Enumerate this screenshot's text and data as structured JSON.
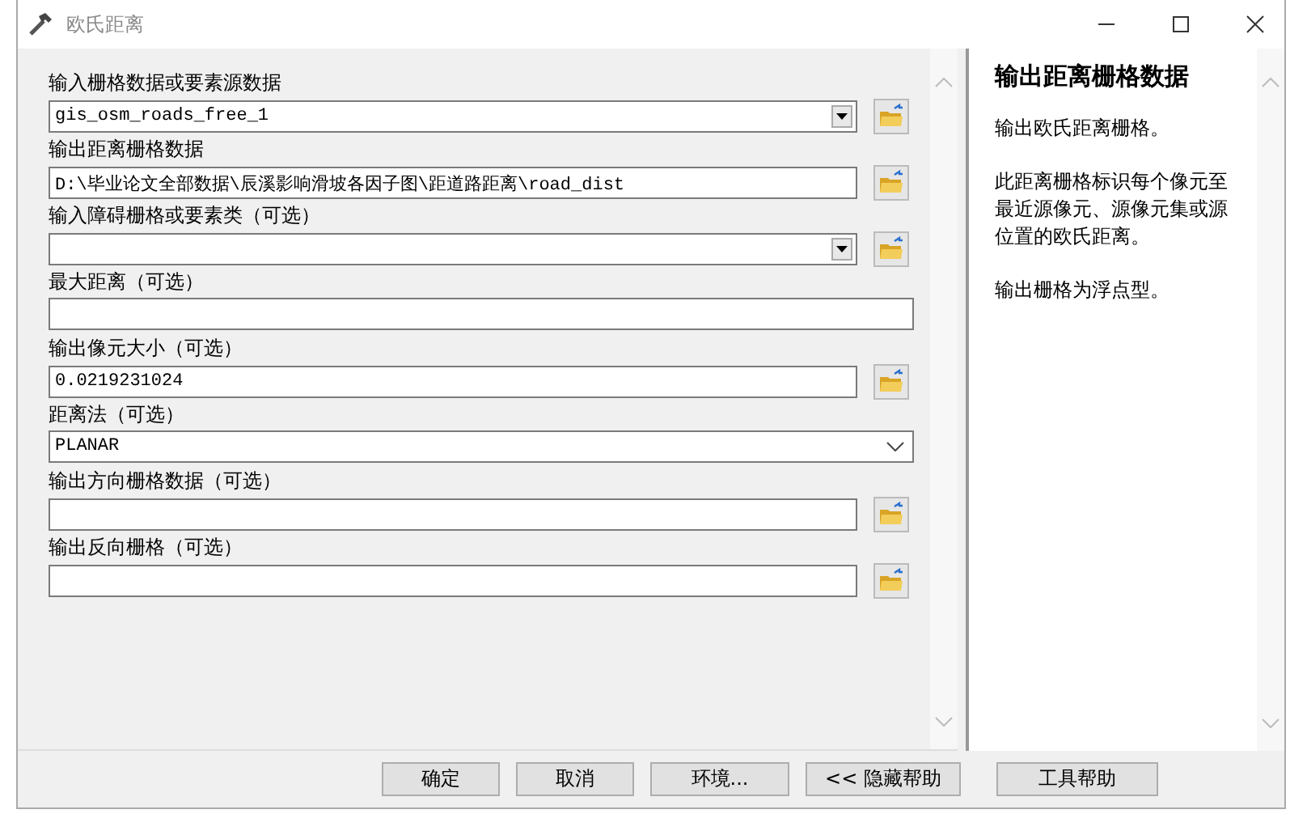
{
  "window": {
    "title": "欧氏距离"
  },
  "fields": [
    {
      "label": "输入栅格数据或要素源数据",
      "kind": "combo",
      "value": "gis_osm_roads_free_1"
    },
    {
      "label": "输出距离栅格数据",
      "kind": "text",
      "browse": true,
      "value": "D:\\毕业论文全部数据\\辰溪影响滑坡各因子图\\距道路距离\\road_dist"
    },
    {
      "label": "输入障碍栅格或要素类（可选）",
      "kind": "combo"
    },
    {
      "label": "最大距离（可选）",
      "kind": "text",
      "browse": false
    },
    {
      "label": "输出像元大小（可选）",
      "kind": "text",
      "browse": true,
      "value": "0.0219231024"
    },
    {
      "label": "距离法（可选）",
      "kind": "select",
      "value": "PLANAR"
    },
    {
      "label": "输出方向栅格数据（可选）",
      "kind": "text",
      "browse": true
    },
    {
      "label": "输出反向栅格（可选）",
      "kind": "text",
      "browse": true
    }
  ],
  "help": {
    "title": "输出距离栅格数据",
    "paragraphs": [
      "输出欧氏距离栅格。",
      "此距离栅格标识每个像元至最近源像元、源像元集或源位置的欧氏距离。",
      "输出栅格为浮点型。"
    ]
  },
  "buttons": [
    "确定",
    "取消",
    "环境...",
    "<< 隐藏帮助",
    "工具帮助"
  ]
}
